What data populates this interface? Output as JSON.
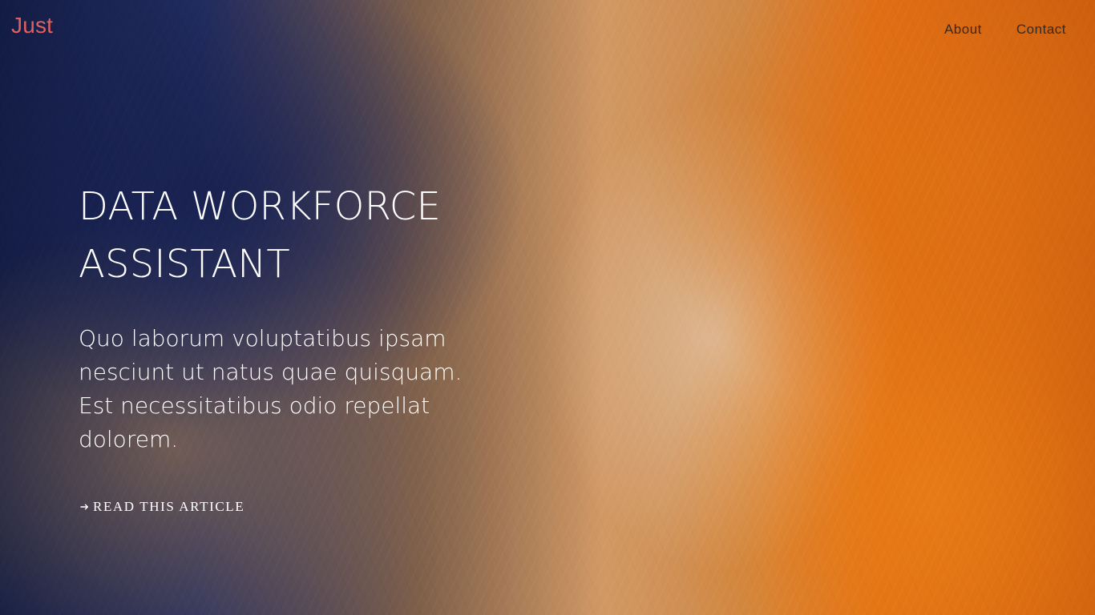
{
  "brand": {
    "text": "Just",
    "color": "#e0605f"
  },
  "nav": {
    "items": [
      {
        "label": "About"
      },
      {
        "label": "Contact"
      }
    ]
  },
  "hero": {
    "title_lines": [
      "DATA WORKFORCE",
      "ASSISTANT"
    ],
    "description": "Quo laborum voluptatibus ipsam nesciunt ut natus quae quisquam. Est necessitatibus odio repellat dolorem.",
    "cta": {
      "label": "READ THIS ARTICLE",
      "icon": "arrow-right-icon"
    }
  }
}
